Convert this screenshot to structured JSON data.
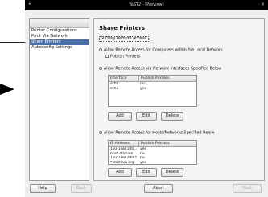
{
  "window": {
    "title": "YaST2 - [Preview]",
    "controls_left": "•",
    "controls_right": "×"
  },
  "sidebar": {
    "items": [
      "Printer Configurations",
      "Print Via Network",
      "Share Printers",
      "Autoconfig Settings"
    ]
  },
  "panel": {
    "title": "Share Printers",
    "deny_remote": "Deny Remote Access",
    "allow_local": "Allow Remote Access for Computers within the Local Network",
    "publish_printers": "Publish Printers",
    "allow_interfaces": "Allow Remote Access via Network Interfaces Specified Below",
    "iface_table": {
      "headers": [
        "Interface",
        "Publish Printers"
      ],
      "rows": [
        [
          "eth0",
          "no"
        ],
        [
          "eth1",
          "yes"
        ]
      ]
    },
    "allow_hosts": "Allow Remote Access for Hosts/Networks Specified Below",
    "host_table": {
      "headers": [
        "IP Address",
        "Publish Printers"
      ],
      "rows": [
        [
          "192.168.100...",
          "yes"
        ],
        [
          "host.domain...",
          "no"
        ],
        [
          "192.168.200.*",
          "no"
        ],
        [
          "*.domain.org",
          "yes"
        ]
      ]
    },
    "buttons": {
      "add": "Add",
      "edit": "Edit",
      "delete": "Delete"
    }
  },
  "footer": {
    "help": "Help",
    "back": "Back",
    "abort": "Abort",
    "next": "Next"
  }
}
